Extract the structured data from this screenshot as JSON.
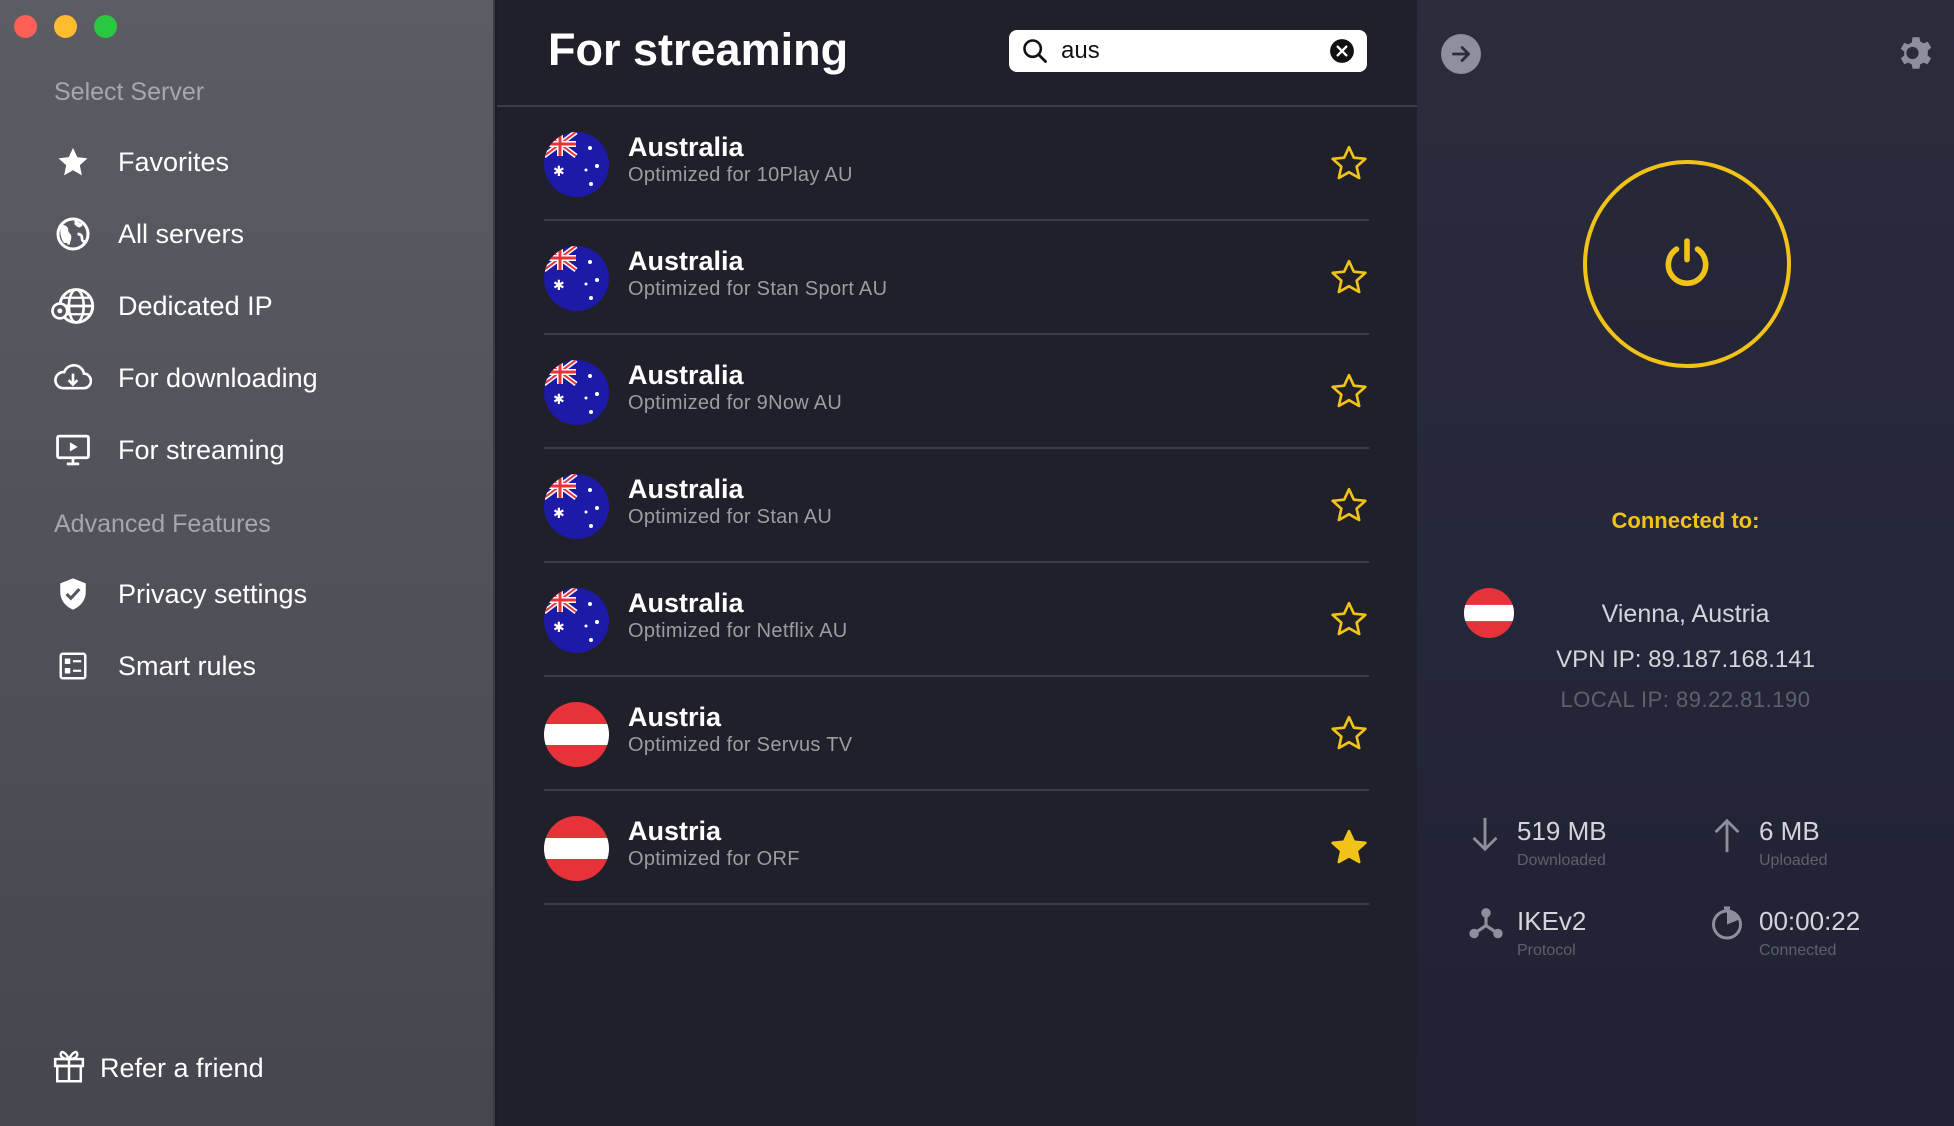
{
  "window": {
    "traffic_lights": [
      "close",
      "minimize",
      "zoom"
    ]
  },
  "sidebar": {
    "select_heading": "Select Server",
    "items": [
      {
        "label": "Favorites",
        "icon": "star-icon"
      },
      {
        "label": "All servers",
        "icon": "globe-icon"
      },
      {
        "label": "Dedicated IP",
        "icon": "dedicated-ip-icon"
      },
      {
        "label": "For downloading",
        "icon": "cloud-download-icon"
      },
      {
        "label": "For streaming",
        "icon": "streaming-icon"
      }
    ],
    "advanced_heading": "Advanced Features",
    "advanced_items": [
      {
        "label": "Privacy settings",
        "icon": "shield-icon"
      },
      {
        "label": "Smart rules",
        "icon": "rules-icon"
      }
    ],
    "refer_label": "Refer a friend"
  },
  "main": {
    "title": "For streaming",
    "search": {
      "value": "aus",
      "placeholder": ""
    },
    "servers": [
      {
        "country": "Australia",
        "subtitle": "Optimized for 10Play AU",
        "flag": "au",
        "favorite": false
      },
      {
        "country": "Australia",
        "subtitle": "Optimized for Stan Sport AU",
        "flag": "au",
        "favorite": false
      },
      {
        "country": "Australia",
        "subtitle": "Optimized for 9Now AU",
        "flag": "au",
        "favorite": false
      },
      {
        "country": "Australia",
        "subtitle": "Optimized for Stan AU",
        "flag": "au",
        "favorite": false
      },
      {
        "country": "Australia",
        "subtitle": "Optimized for Netflix AU",
        "flag": "au",
        "favorite": false
      },
      {
        "country": "Austria",
        "subtitle": "Optimized for Servus TV",
        "flag": "at",
        "favorite": false
      },
      {
        "country": "Austria",
        "subtitle": "Optimized for ORF",
        "flag": "at",
        "favorite": true
      }
    ]
  },
  "status": {
    "connected_label": "Connected to:",
    "location": "Vienna, Austria",
    "vpn_ip": "VPN IP: 89.187.168.141",
    "local_ip": "LOCAL IP: 89.22.81.190",
    "downloaded": {
      "value": "519 MB",
      "caption": "Downloaded"
    },
    "uploaded": {
      "value": "6 MB",
      "caption": "Uploaded"
    },
    "protocol": {
      "value": "IKEv2",
      "caption": "Protocol"
    },
    "time": {
      "value": "00:00:22",
      "caption": "Connected"
    }
  },
  "colors": {
    "accent": "#f2c317",
    "sidebar_bg": "#55565e",
    "list_bg": "#1f2029",
    "status_bg": "#282a3b",
    "austria_red": "#e8323a",
    "australia_blue": "#1d1aa8"
  }
}
